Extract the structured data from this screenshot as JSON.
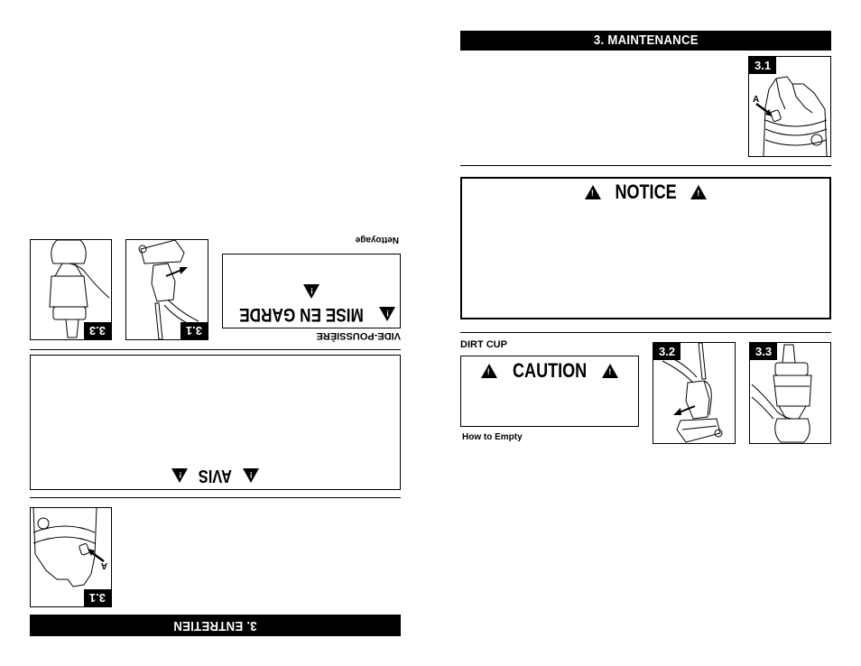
{
  "english_page": {
    "section_header": "3. MAINTENANCE",
    "figure_3_1": {
      "label": "3.1",
      "callout": "A"
    },
    "notice": {
      "title": "NOTICE",
      "icon": "warning-triangle-icon"
    },
    "dirt_cup_heading": "DIRT CUP",
    "caution": {
      "title": "CAUTION",
      "icon": "warning-triangle-icon"
    },
    "how_to_empty": "How to Empty",
    "figure_3_2": {
      "label": "3.2"
    },
    "figure_3_3": {
      "label": "3.3"
    }
  },
  "french_page": {
    "orientation": "upside-down",
    "section_header": "3. ENTRETIEN",
    "figure_3_1": {
      "label": "3.1",
      "callout": "A"
    },
    "avis": {
      "title": "AVIS",
      "icon": "warning-triangle-icon"
    },
    "vide_poussiere_heading": "VIDE-POUSSIÈRE",
    "mise_en_garde": {
      "title": "MISE EN GARDE",
      "icon": "warning-triangle-icon"
    },
    "nettoyage": "Nettoyage",
    "figure_a": {
      "label": "3.1"
    },
    "figure_b": {
      "label": "3.3"
    }
  }
}
